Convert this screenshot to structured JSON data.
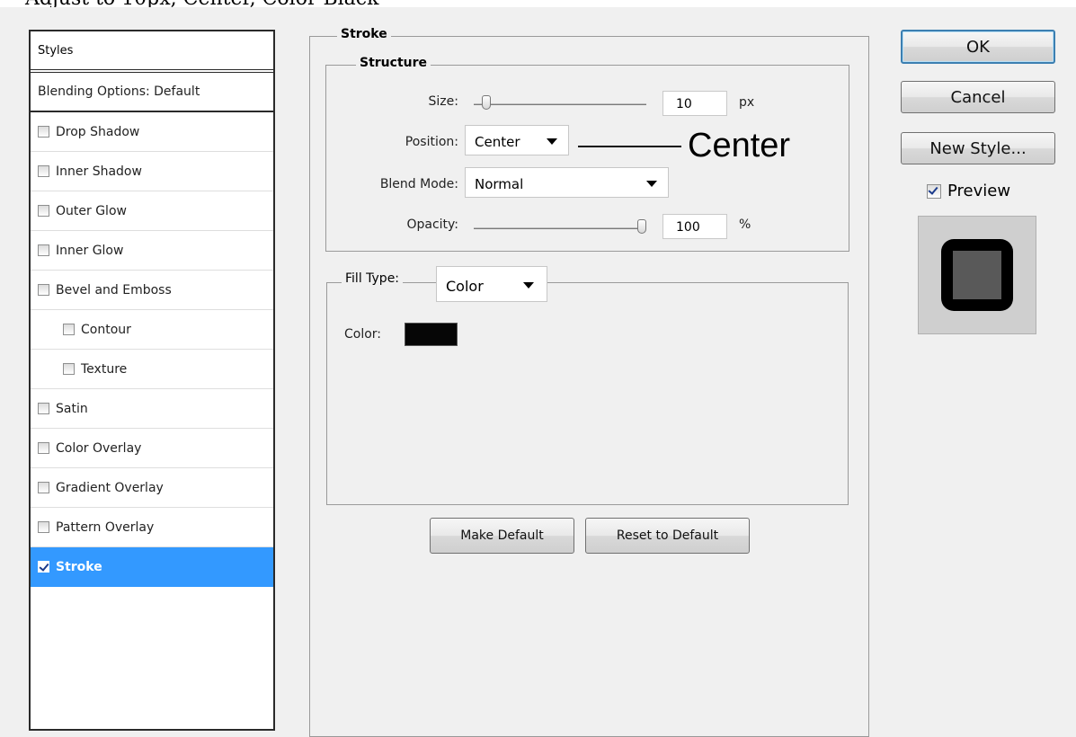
{
  "top_text": "Adjust to 10px, Center, Color Black",
  "styles_panel": {
    "header": "Styles",
    "blending_options": "Blending Options: Default",
    "items": [
      {
        "label": "Drop Shadow",
        "checked": false,
        "indent": false
      },
      {
        "label": "Inner Shadow",
        "checked": false,
        "indent": false
      },
      {
        "label": "Outer Glow",
        "checked": false,
        "indent": false
      },
      {
        "label": "Inner Glow",
        "checked": false,
        "indent": false
      },
      {
        "label": "Bevel and Emboss",
        "checked": false,
        "indent": false
      },
      {
        "label": "Contour",
        "checked": false,
        "indent": true
      },
      {
        "label": "Texture",
        "checked": false,
        "indent": true
      },
      {
        "label": "Satin",
        "checked": false,
        "indent": false
      },
      {
        "label": "Color Overlay",
        "checked": false,
        "indent": false
      },
      {
        "label": "Gradient Overlay",
        "checked": false,
        "indent": false
      },
      {
        "label": "Pattern Overlay",
        "checked": false,
        "indent": false
      },
      {
        "label": "Stroke",
        "checked": true,
        "indent": false,
        "selected": true
      }
    ]
  },
  "stroke": {
    "title": "Stroke",
    "structure": {
      "title": "Structure",
      "size_label": "Size:",
      "size_value": "10",
      "size_unit": "px",
      "size_slider_fraction": 0.1,
      "position_label": "Position:",
      "position_value": "Center",
      "annotation": "Center",
      "blend_label": "Blend Mode:",
      "blend_value": "Normal",
      "opacity_label": "Opacity:",
      "opacity_value": "100",
      "opacity_unit": "%",
      "opacity_slider_fraction": 1.0
    },
    "fill": {
      "fill_type_label": "Fill Type:",
      "fill_type_value": "Color",
      "color_label": "Color:",
      "color_hex": "#060606"
    },
    "make_default": "Make Default",
    "reset_default": "Reset to Default"
  },
  "buttons": {
    "ok": "OK",
    "cancel": "Cancel",
    "new_style": "New Style...",
    "preview_label": "Preview",
    "preview_checked": true
  },
  "colors": {
    "selection": "#3399ff",
    "background": "#f0f0f0",
    "ok_border": "#3c7fb1"
  }
}
